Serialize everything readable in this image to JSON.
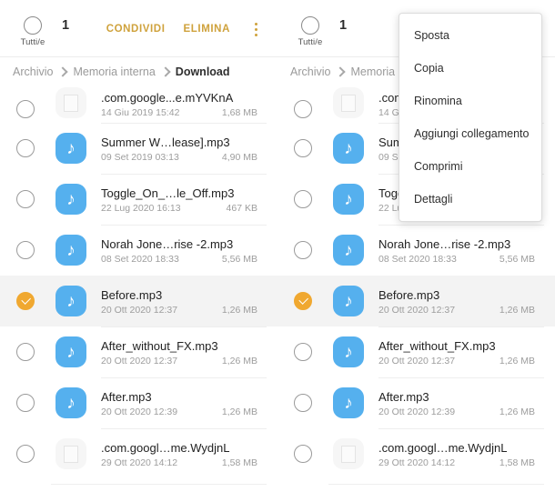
{
  "toolbar": {
    "select_all_label": "Tutti/e",
    "selected_count": "1",
    "share_label": "CONDIVIDI",
    "delete_label": "ELIMINA",
    "more_icon": "kebab-menu-icon",
    "accent_color": "#cfa23c"
  },
  "breadcrumb_left": [
    "Archivio",
    "Memoria interna",
    "Download"
  ],
  "breadcrumb_right": [
    "Archivio",
    "Memoria interna"
  ],
  "popup_menu": {
    "items": [
      "Sposta",
      "Copia",
      "Rinomina",
      "Aggiungi collegamento",
      "Comprimi",
      "Dettagli"
    ]
  },
  "colors": {
    "selected_check": "#f0a830",
    "audio_icon": "#55b0ee",
    "selected_row_bg": "#f3f3f3"
  },
  "files": [
    {
      "name": ".com.google...e.mYVKnA",
      "date": "14 Giu 2019 15:42",
      "size": "1,68 MB",
      "type": "doc",
      "selected": false
    },
    {
      "name": "Summer W…lease].mp3",
      "date": "09 Set 2019 03:13",
      "size": "4,90 MB",
      "type": "audio",
      "selected": false
    },
    {
      "name": "Toggle_On_…le_Off.mp3",
      "date": "22 Lug 2020 16:13",
      "size": "467 KB",
      "type": "audio",
      "selected": false
    },
    {
      "name": "Norah Jone…rise -2.mp3",
      "date": "08 Set 2020 18:33",
      "size": "5,56 MB",
      "type": "audio",
      "selected": false
    },
    {
      "name": "Before.mp3",
      "date": "20 Ott 2020 12:37",
      "size": "1,26 MB",
      "type": "audio",
      "selected": true
    },
    {
      "name": "After_without_FX.mp3",
      "date": "20 Ott 2020 12:37",
      "size": "1,26 MB",
      "type": "audio",
      "selected": false
    },
    {
      "name": "After.mp3",
      "date": "20 Ott 2020 12:39",
      "size": "1,26 MB",
      "type": "audio",
      "selected": false
    },
    {
      "name": ".com.googl…me.WydjnL",
      "date": "29 Ott 2020 14:12",
      "size": "1,58 MB",
      "type": "doc",
      "selected": false
    }
  ]
}
